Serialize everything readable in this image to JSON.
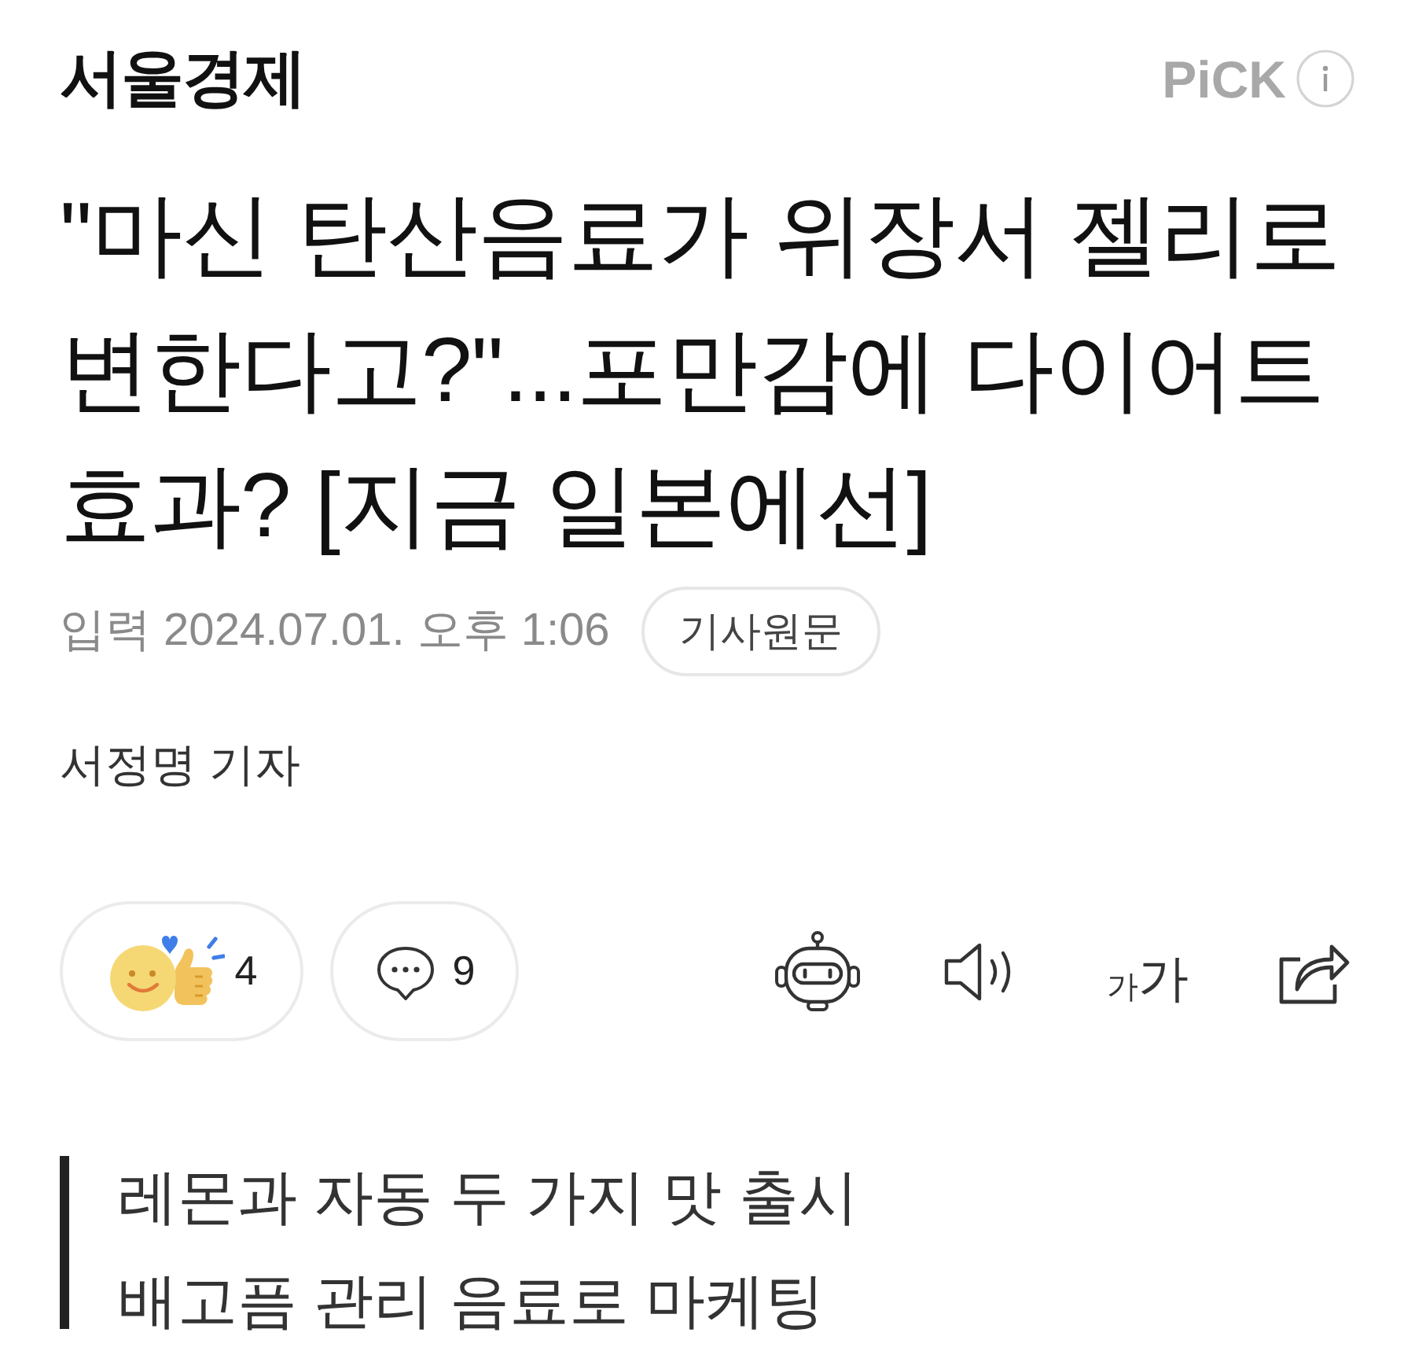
{
  "header": {
    "logo": "서울경제",
    "badge": "PiCK"
  },
  "headline_lines": [
    "\"마신 탄산음료가 위장서 젤리로",
    "변한다고?\"...포만감에 다이어트",
    "효과? [지금 일본에선]"
  ],
  "meta": {
    "published": "입력 2024.07.01. 오후 1:06",
    "original_link": "기사원문"
  },
  "byline": "서정명 기자",
  "reactions": [
    {
      "kind": "like",
      "count": "4"
    },
    {
      "kind": "comment",
      "count": "9"
    }
  ],
  "tools": [
    {
      "kind": "bot"
    },
    {
      "kind": "audio"
    },
    {
      "kind": "font_size",
      "small": "가",
      "large": "가"
    },
    {
      "kind": "share"
    }
  ],
  "summary": [
    "레몬과 자동 두 가지 맛 출시",
    "배고픔 관리 음료로 마케팅"
  ]
}
